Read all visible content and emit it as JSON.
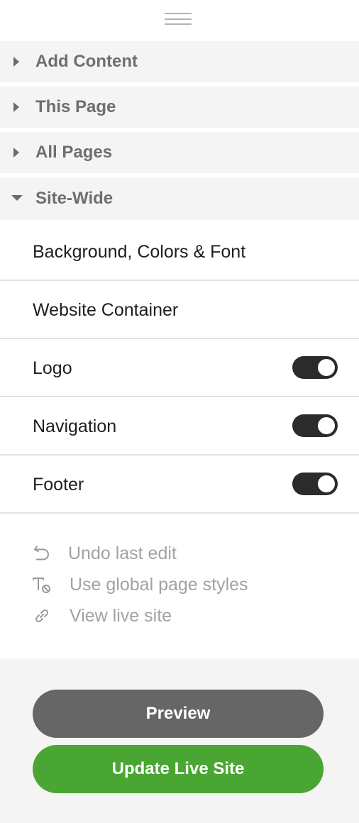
{
  "sections": [
    {
      "label": "Add Content",
      "expanded": false
    },
    {
      "label": "This Page",
      "expanded": false
    },
    {
      "label": "All Pages",
      "expanded": false
    },
    {
      "label": "Site-Wide",
      "expanded": true
    }
  ],
  "site_wide": {
    "items": [
      {
        "label": "Background, Colors & Font"
      },
      {
        "label": "Website Container"
      },
      {
        "label": "Logo",
        "toggle_on": true
      },
      {
        "label": "Navigation",
        "toggle_on": true
      },
      {
        "label": "Footer",
        "toggle_on": true
      }
    ]
  },
  "actions": [
    {
      "label": "Undo last edit",
      "icon": "undo-icon"
    },
    {
      "label": "Use global page styles",
      "icon": "text-style-reset-icon"
    },
    {
      "label": "View live site",
      "icon": "link-icon"
    }
  ],
  "footer": {
    "preview_label": "Preview",
    "update_label": "Update Live Site"
  },
  "colors": {
    "section_bg": "#f4f4f4",
    "toggle_on": "#2b2b2e",
    "preview_button": "#666666",
    "update_button": "#4aa632",
    "muted_text": "#a2a2a2"
  }
}
